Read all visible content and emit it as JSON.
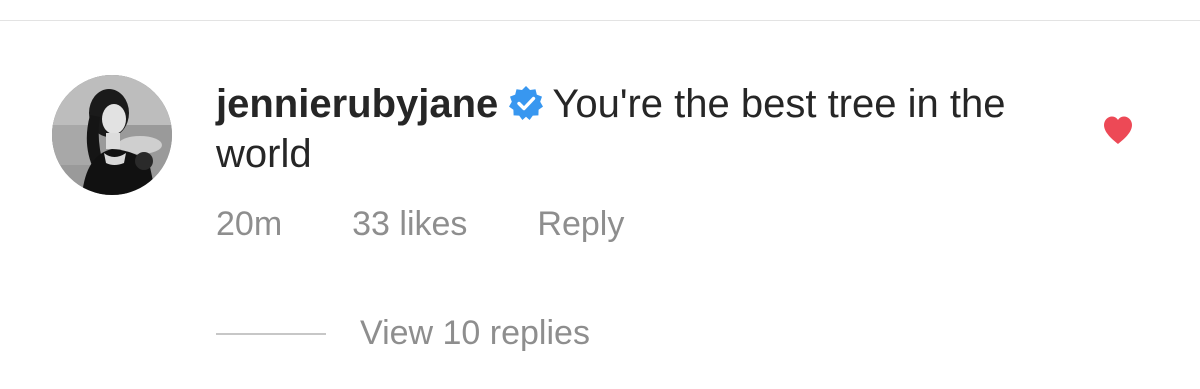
{
  "comment": {
    "username": "jennierubyjane",
    "text": "You're the best tree in the world",
    "time": "20m",
    "likes": "33 likes",
    "reply_label": "Reply",
    "verified_icon": "verified-badge-icon",
    "heart_icon": "heart-filled-icon",
    "heart_color": "#ed4956",
    "verified_color": "#3897f0"
  },
  "replies": {
    "label": "View 10 replies"
  }
}
